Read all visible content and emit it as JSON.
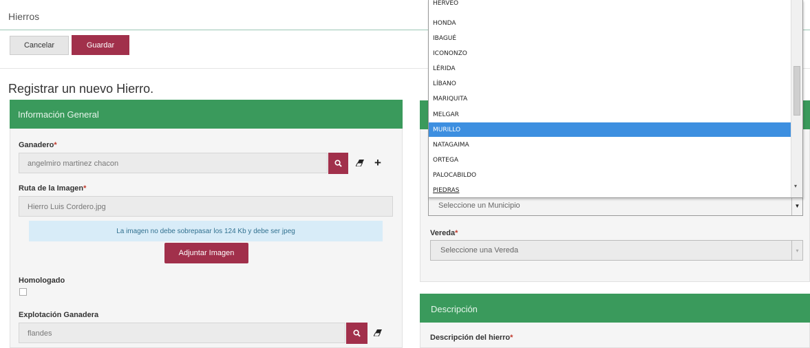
{
  "header": {
    "title": "Hierros"
  },
  "toolbar": {
    "cancel_label": "Cancelar",
    "save_label": "Guardar"
  },
  "page": {
    "heading": "Registrar un nuevo Hierro."
  },
  "general_panel": {
    "title": "Información General",
    "ganadero": {
      "label": "Ganadero",
      "required": "*",
      "value": "angelmiro martinez chacon"
    },
    "ruta_imagen": {
      "label": "Ruta de la Imagen",
      "required": "*",
      "value": "Hierro Luis Cordero.jpg"
    },
    "info_message": "La imagen no debe sobrepasar los 124 Kb y debe ser jpeg",
    "attach_button": "Adjuntar Imagen",
    "homologado": {
      "label": "Homologado",
      "checked": false
    },
    "explotacion": {
      "label": "Explotación Ganadera",
      "value": "flandes"
    }
  },
  "location_panel": {
    "municipio": {
      "placeholder": "Seleccione un Municipio"
    },
    "vereda": {
      "label": "Vereda",
      "required": "*",
      "placeholder": "Seleccione una Vereda"
    }
  },
  "description_panel": {
    "title": "Descripción",
    "descripcion": {
      "label": "Descripción del hierro",
      "required": "*"
    }
  },
  "municipio_dropdown": {
    "items": [
      "HERVEO",
      "HONDA",
      "IBAGUÉ",
      "ICONONZO",
      "LÉRIDA",
      "LÍBANO",
      "MARIQUITA",
      "MELGAR",
      "MURILLO",
      "NATAGAIMA",
      "ORTEGA",
      "PALOCABILDO",
      "PIEDRAS"
    ],
    "selected": "MURILLO"
  },
  "colors": {
    "primary": "#a1304b",
    "panel_header": "#3a9a5c",
    "selection": "#3d8fe0",
    "info_bg": "#d8ecf8"
  },
  "icons": {
    "search": "search-icon",
    "eraser": "eraser-icon",
    "add": "plus-icon"
  }
}
